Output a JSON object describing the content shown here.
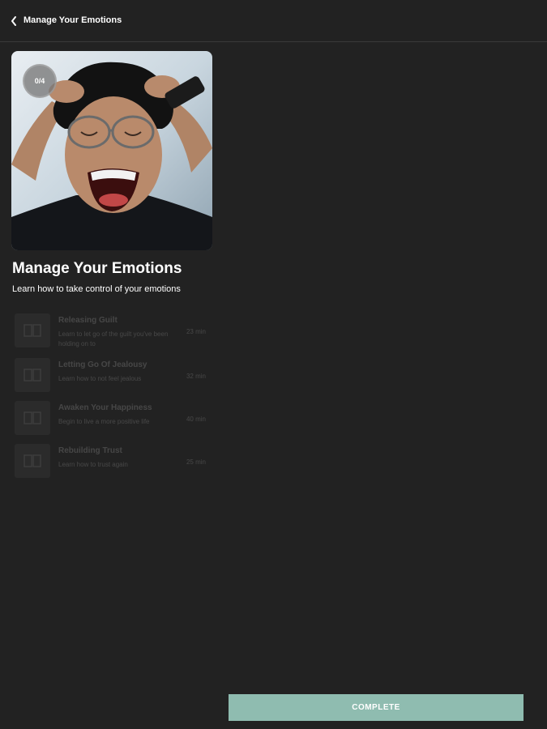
{
  "header": {
    "title": "Manage Your Emotions",
    "back_icon": "chevron-left-icon"
  },
  "course": {
    "progress": "0/4",
    "progress_completed": 0,
    "progress_total": 4,
    "title": "Manage Your Emotions",
    "subtitle": "Learn how to take control of your emotions"
  },
  "lessons": [
    {
      "title": "Releasing Guilt",
      "description": "Learn to let go of the guilt you've been holding on to",
      "duration": "23 min",
      "icon": "book-icon"
    },
    {
      "title": "Letting Go Of Jealousy",
      "description": "Learn how to not feel jealous",
      "duration": "32 min",
      "icon": "book-icon"
    },
    {
      "title": "Awaken Your Happiness",
      "description": "Begin to live a more positive life",
      "duration": "40 min",
      "icon": "book-icon"
    },
    {
      "title": "Rebuilding Trust",
      "description": "Learn how to trust again",
      "duration": "25 min",
      "icon": "book-icon"
    }
  ],
  "footer": {
    "complete_label": "COMPLETE"
  },
  "colors": {
    "background": "#222222",
    "accent": "#8fbcb0",
    "badge": "#787878"
  }
}
